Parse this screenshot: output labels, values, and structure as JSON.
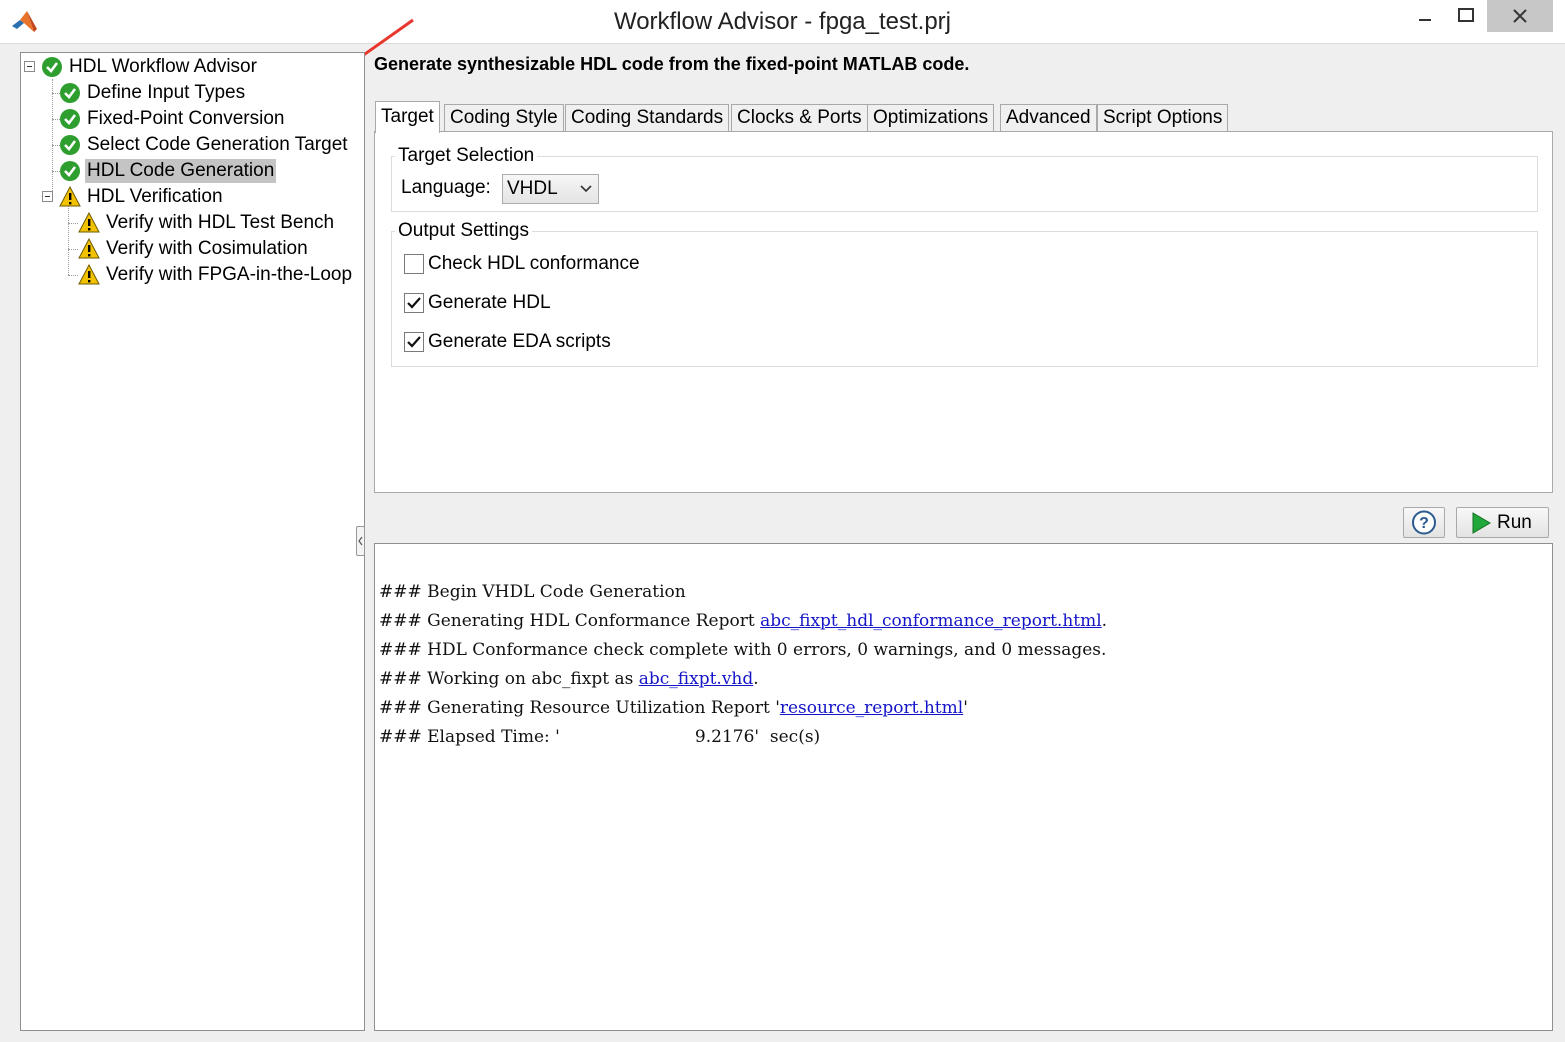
{
  "window": {
    "title": "Workflow Advisor - fpga_test.prj"
  },
  "tree": {
    "root": {
      "label": "HDL Workflow Advisor",
      "status": "passed"
    },
    "items": [
      {
        "label": "Define Input Types",
        "status": "passed"
      },
      {
        "label": "Fixed-Point Conversion",
        "status": "passed"
      },
      {
        "label": "Select Code Generation Target",
        "status": "passed"
      },
      {
        "label": "HDL Code Generation",
        "status": "passed",
        "selected": true
      },
      {
        "label": "HDL Verification",
        "status": "warning"
      },
      {
        "label": "Verify with HDL Test Bench",
        "status": "warning"
      },
      {
        "label": "Verify with Cosimulation",
        "status": "warning"
      },
      {
        "label": "Verify with FPGA-in-the-Loop",
        "status": "warning"
      }
    ]
  },
  "main": {
    "heading": "Generate synthesizable HDL code from the fixed-point MATLAB code.",
    "tabs": [
      {
        "label": "Target",
        "active": true
      },
      {
        "label": "Coding Style"
      },
      {
        "label": "Coding Standards"
      },
      {
        "label": "Clocks & Ports"
      },
      {
        "label": "Optimizations"
      },
      {
        "label": "Advanced"
      },
      {
        "label": "Script Options"
      }
    ],
    "target_selection": {
      "title": "Target Selection",
      "language_label": "Language:",
      "language_value": "VHDL"
    },
    "output_settings": {
      "title": "Output Settings",
      "options": [
        {
          "label": "Check HDL conformance",
          "checked": false
        },
        {
          "label": "Generate HDL",
          "checked": true
        },
        {
          "label": "Generate EDA scripts",
          "checked": true
        }
      ]
    },
    "buttons": {
      "help_icon": "question-mark-icon",
      "run_label": "Run"
    }
  },
  "console": {
    "lines": [
      {
        "text": "### Begin VHDL Code Generation"
      },
      {
        "prefix": "### Generating HDL Conformance Report ",
        "link": "abc_fixpt_hdl_conformance_report.html",
        "suffix": "."
      },
      {
        "text": "### HDL Conformance check complete with 0 errors, 0 warnings, and 0 messages."
      },
      {
        "prefix": "### Working on abc_fixpt as ",
        "link": "abc_fixpt.vhd",
        "suffix": "."
      },
      {
        "prefix": "### Generating Resource Utilization Report '",
        "link": "resource_report.html",
        "suffix": "'"
      },
      {
        "text": "### Elapsed Time: '                         9.2176'  sec(s)"
      }
    ]
  },
  "colors": {
    "pass_green": "#2e9e2e",
    "warning_yellow": "#f2c200",
    "link_blue": "#1414c8",
    "annotation_red": "#e8372c"
  }
}
